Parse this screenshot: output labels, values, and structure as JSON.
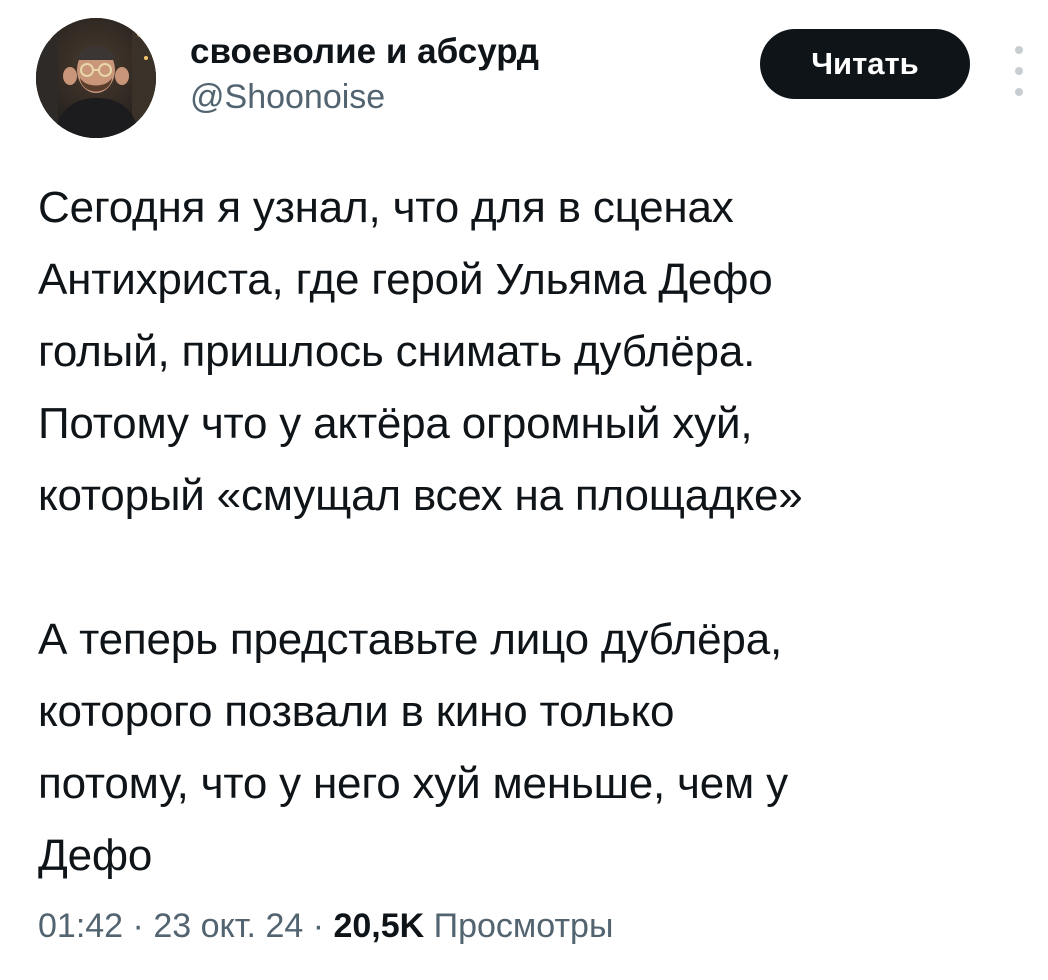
{
  "author": {
    "display_name": "своеволие и абсурд",
    "handle": "@Shoonoise",
    "avatar_icon": "user-avatar-photo"
  },
  "actions": {
    "follow_label": "Читать",
    "more_icon": "more-vertical-icon"
  },
  "tweet": {
    "paragraphs": [
      {
        "lines": [
          "Сегодня я узнал, что для в сценах",
          "Антихриста, где герой Ульяма Дефо",
          "голый, пришлось снимать дублёра.",
          "Потому что у актёра огромный хуй,",
          "который «смущал всех на площадке»"
        ]
      },
      {
        "lines": [
          "А теперь представьте лицо дублёра,",
          "которого позвали в кино только",
          "потому, что у него хуй меньше, чем у",
          "Дефо"
        ]
      }
    ]
  },
  "meta": {
    "time": "01:42",
    "sep1": " · ",
    "date": "23 окт. 24",
    "sep2": " · ",
    "views_count": "20,5K",
    "views_label": " Просмотры"
  },
  "colors": {
    "text_primary": "#0f1419",
    "text_secondary": "#536471",
    "button_bg": "#0f1419",
    "button_text": "#ffffff",
    "background": "#ffffff"
  }
}
